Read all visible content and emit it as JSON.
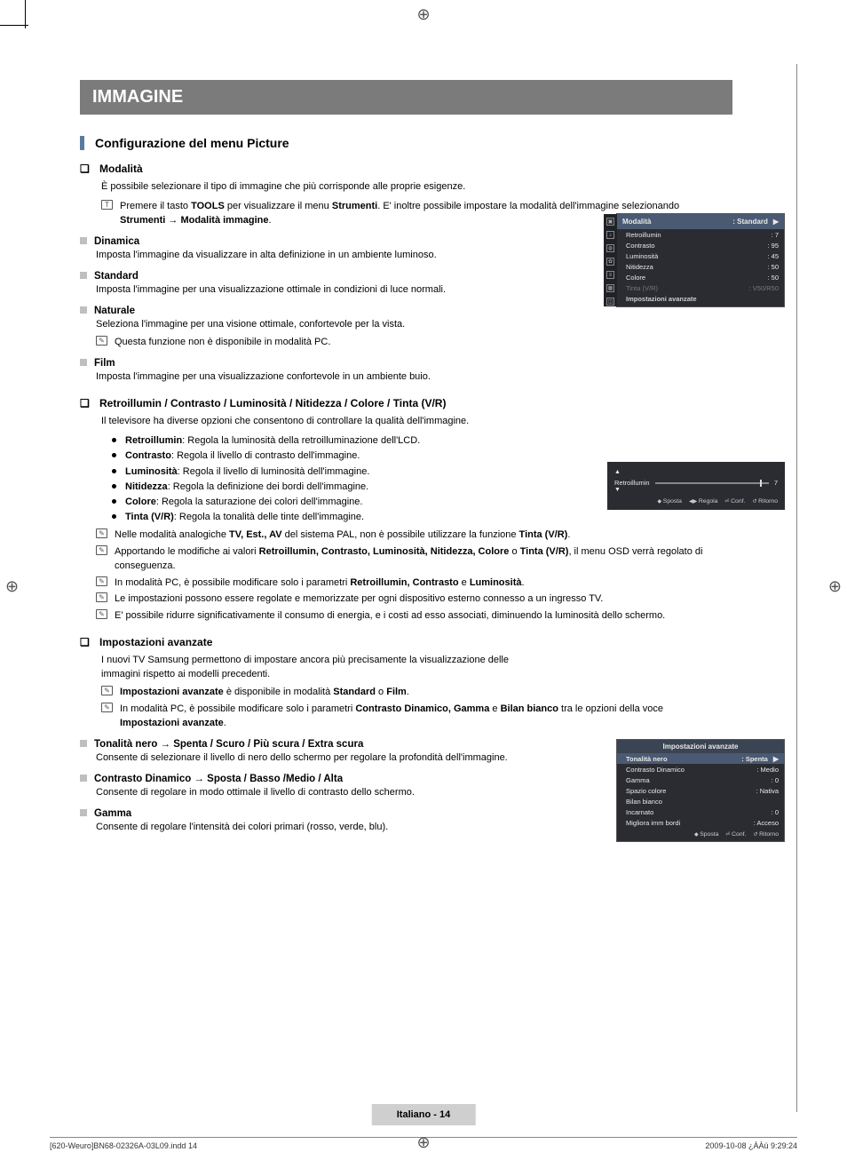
{
  "title_bar": "IMMAGINE",
  "sec_heading": "Configurazione del menu Picture",
  "q_mark": "❏",
  "sq_mark": "■",
  "modalita": {
    "heading": "Modalità",
    "intro": "È possibile selezionare il tipo di immagine che più corrisponde alle proprie esigenze.",
    "tools_note": "Premere il tasto TOOLS per visualizzare il menu Strumenti. E' inoltre possibile impostare la modalità dell'immagine selezionando Strumenti → Modalità immagine.",
    "items": [
      {
        "name": "Dinamica",
        "desc": "Imposta l'immagine da visualizzare in alta definizione in un ambiente luminoso."
      },
      {
        "name": "Standard",
        "desc": "Imposta l'immagine per una visualizzazione ottimale in condizioni di luce normali."
      },
      {
        "name": "Naturale",
        "desc": "Seleziona l'immagine per una visione ottimale, confortevole per la vista.",
        "note": "Questa funzione non è disponibile in modalità PC."
      },
      {
        "name": "Film",
        "desc": "Imposta l'immagine per una visualizzazione confortevole in un ambiente buio."
      }
    ]
  },
  "parametri": {
    "heading": "Retroillumin / Contrasto / Luminosità / Nitidezza / Colore / Tinta (V/R)",
    "intro": "Il televisore ha diverse opzioni che consentono di controllare la qualità dell'immagine.",
    "bullets": [
      {
        "b": "Retroillumin",
        "t": ": Regola la luminosità della retroilluminazione dell'LCD."
      },
      {
        "b": "Contrasto",
        "t": ": Regola il livello di contrasto dell'immagine."
      },
      {
        "b": "Luminosità",
        "t": ": Regola il livello di luminosità dell'immagine."
      },
      {
        "b": "Nitidezza",
        "t": ": Regola la definizione dei bordi dell'immagine."
      },
      {
        "b": "Colore",
        "t": ": Regola la saturazione dei colori dell'immagine."
      },
      {
        "b": "Tinta (V/R)",
        "t": ": Regola la tonalità delle tinte dell'immagine."
      }
    ],
    "notes": [
      "Nelle modalità analogiche TV, Est., AV del sistema PAL, non è possibile utilizzare la funzione Tinta (V/R).",
      "Apportando le modifiche ai valori Retroillumin, Contrasto, Luminosità, Nitidezza, Colore o Tinta (V/R), il menu OSD verrà regolato di conseguenza.",
      "In modalità PC, è possibile modificare solo i parametri Retroillumin, Contrasto e Luminosità.",
      "Le impostazioni possono essere regolate e memorizzate per ogni dispositivo esterno connesso a un ingresso TV.",
      "E' possibile ridurre significativamente il consumo di energia, e i costi ad esso associati, diminuendo la luminosità dello schermo."
    ]
  },
  "avanzate": {
    "heading": "Impostazioni avanzate",
    "intro": "I nuovi TV Samsung permettono di impostare ancora più precisamente la visualizzazione delle immagini rispetto ai modelli precedenti.",
    "notes": [
      "Impostazioni avanzate è disponibile in modalità Standard o Film.",
      "In modalità PC, è possibile modificare solo i parametri Contrasto Dinamico, Gamma e Bilan bianco tra le opzioni della voce Impostazioni avanzate."
    ],
    "subs": [
      {
        "name": "Tonalità nero → Spenta / Scuro / Più scura / Extra scura",
        "desc": "Consente di selezionare il livello di nero dello schermo per regolare la profondità dell'immagine."
      },
      {
        "name": "Contrasto Dinamico → Sposta / Basso /Medio / Alta",
        "desc": "Consente di regolare in modo ottimale il livello di contrasto dello schermo."
      },
      {
        "name": "Gamma",
        "desc": "Consente di regolare l'intensità dei colori primari (rosso, verde, blu)."
      }
    ]
  },
  "osd_menu": {
    "side_label": "Immagine",
    "header_label": "Modalità",
    "header_value": ": Standard",
    "rows": [
      {
        "k": "Retroillumin",
        "v": ": 7"
      },
      {
        "k": "Contrasto",
        "v": ": 95"
      },
      {
        "k": "Luminosità",
        "v": ": 45"
      },
      {
        "k": "Nitidezza",
        "v": ": 50"
      },
      {
        "k": "Colore",
        "v": ": 50"
      }
    ],
    "disabled_row": {
      "k": "Tinta (V/R)",
      "v": ": V50/R50"
    },
    "footer": "Impostazioni avanzate"
  },
  "osd_slider": {
    "label": "Retroillumin",
    "value": "7",
    "help": {
      "sposta": "Sposta",
      "regola": "Regola",
      "conf": "Conf.",
      "ritorno": "Ritorno"
    }
  },
  "osd_adv": {
    "title": "Impostazioni avanzate",
    "rows": [
      {
        "k": "Tonalità nero",
        "v": ": Spenta",
        "sel": true
      },
      {
        "k": "Contrasto Dinamico",
        "v": ": Medio"
      },
      {
        "k": "Gamma",
        "v": ": 0"
      },
      {
        "k": "Spazio colore",
        "v": ": Nativa"
      },
      {
        "k": "Bilan bianco",
        "v": ""
      },
      {
        "k": "Incarnato",
        "v": ": 0"
      },
      {
        "k": "Migliora imm bordi",
        "v": ": Acceso"
      }
    ],
    "help": {
      "sposta": "Sposta",
      "conf": "Conf.",
      "ritorno": "Ritorno"
    }
  },
  "page_footer": "Italiano - 14",
  "doc_footer_left": "[620-Weuro]BN68-02326A-03L09.indd   14",
  "doc_footer_right": "2009-10-08   ¿ÀÀü 9:29:24"
}
